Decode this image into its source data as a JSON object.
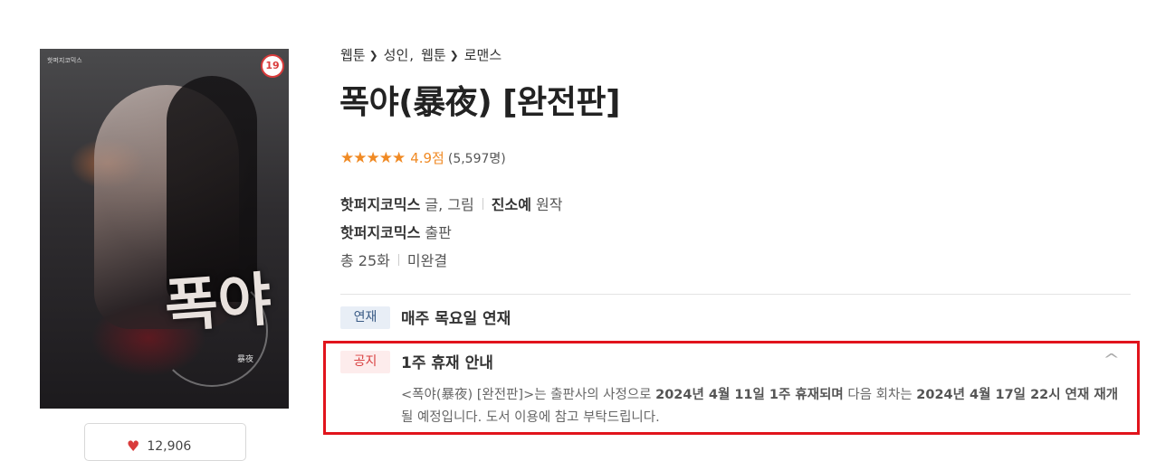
{
  "cover": {
    "publisher_mark": "핫퍼지코믹스",
    "age_rating": "19",
    "logo_text": "폭야",
    "logo_sub": "暴夜"
  },
  "like": {
    "icon": "heart-icon",
    "count": "12,906"
  },
  "breadcrumb": {
    "item1": "웹툰",
    "item2": "성인",
    "item3": "웹툰",
    "item4": "로맨스"
  },
  "title": "폭야(暴夜) [완전판]",
  "rating": {
    "stars": "★★★★★",
    "score": "4.9점",
    "count": "(5,597명)",
    "color": "#f08a24"
  },
  "credits": {
    "author": "핫퍼지코믹스",
    "author_role": "글, 그림",
    "original": "진소예",
    "original_role": "원작",
    "publisher": "핫퍼지코믹스",
    "publisher_role": "출판",
    "episodes": "총 25화",
    "status": "미완결"
  },
  "serial": {
    "tag": "연재",
    "text": "매주 목요일 연재"
  },
  "notice": {
    "tag": "공지",
    "title": "1주 휴재 안내",
    "body_start": "<폭야(暴夜) [완전판]>는 출판사의 사정으로 ",
    "body_bold1": "2024년 4월 11일 1주 휴재되며",
    "body_mid": " 다음 회차는 ",
    "body_bold2": "2024년 4월 17일 22시 연재 재개",
    "body_end": " 될 예정입니다. 도서 이용에 참고 부탁드립니다.",
    "highlight_color": "#e1141c"
  }
}
